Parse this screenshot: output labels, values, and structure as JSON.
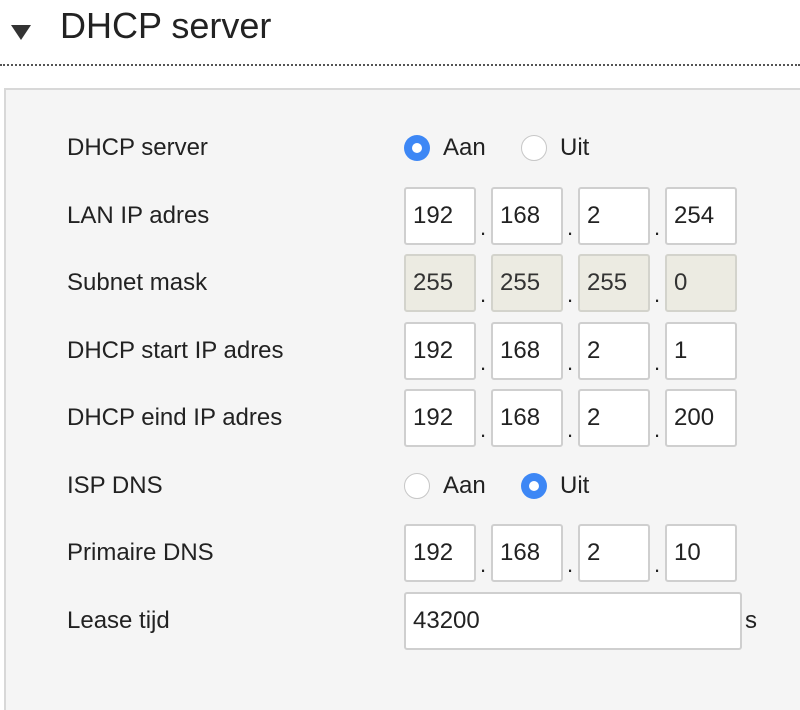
{
  "section": {
    "title": "DHCP server",
    "toggle_icon": "triangle-down-icon"
  },
  "form": {
    "dhcp_server": {
      "label": "DHCP server",
      "on_label": "Aan",
      "off_label": "Uit",
      "selected": "on"
    },
    "lan_ip": {
      "label": "LAN IP adres",
      "octets": [
        "192",
        "168",
        "2",
        "254"
      ]
    },
    "subnet_mask": {
      "label": "Subnet mask",
      "octets": [
        "255",
        "255",
        "255",
        "0"
      ]
    },
    "dhcp_start": {
      "label": "DHCP start IP adres",
      "octets": [
        "192",
        "168",
        "2",
        "1"
      ]
    },
    "dhcp_end": {
      "label": "DHCP eind IP adres",
      "octets": [
        "192",
        "168",
        "2",
        "200"
      ]
    },
    "isp_dns": {
      "label": "ISP DNS",
      "on_label": "Aan",
      "off_label": "Uit",
      "selected": "off"
    },
    "primary_dns": {
      "label": "Primaire DNS",
      "octets": [
        "192",
        "168",
        "2",
        "10"
      ]
    },
    "lease_time": {
      "label": "Lease tijd",
      "value": "43200",
      "unit": "s"
    },
    "separator": "."
  },
  "colors": {
    "radio_checked": "#3d87f5",
    "readonly_field": "#ecebe2",
    "panel_background": "#f5f5f5"
  }
}
